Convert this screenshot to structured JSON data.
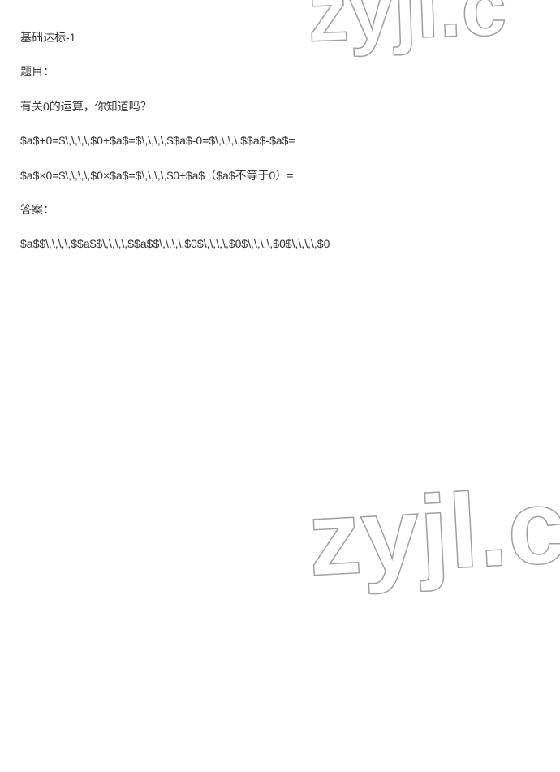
{
  "doc": {
    "heading": "基础达标-1",
    "question_label": "题目：",
    "question_text": "有关0的运算，你知道吗？",
    "expression_line1": "$a$+0=$\\,\\,\\,\\,$0+$a$=$\\,\\,\\,\\,$$a$-0=$\\,\\,\\,\\,$$a$-$a$=",
    "expression_line2": "$a$×0=$\\,\\,\\,\\,$0×$a$=$\\,\\,\\,\\,$0÷$a$（$a$不等于0）=",
    "answer_label": "答案：",
    "answer_text": "$a$$\\,\\,\\,\\,$$a$$\\,\\,\\,\\,$$a$$\\,\\,\\,\\,$0$\\,\\,\\,\\,$0$\\,\\,\\,\\,$0$\\,\\,\\,\\,$0"
  },
  "watermark": {
    "text": "zyjl.c"
  }
}
